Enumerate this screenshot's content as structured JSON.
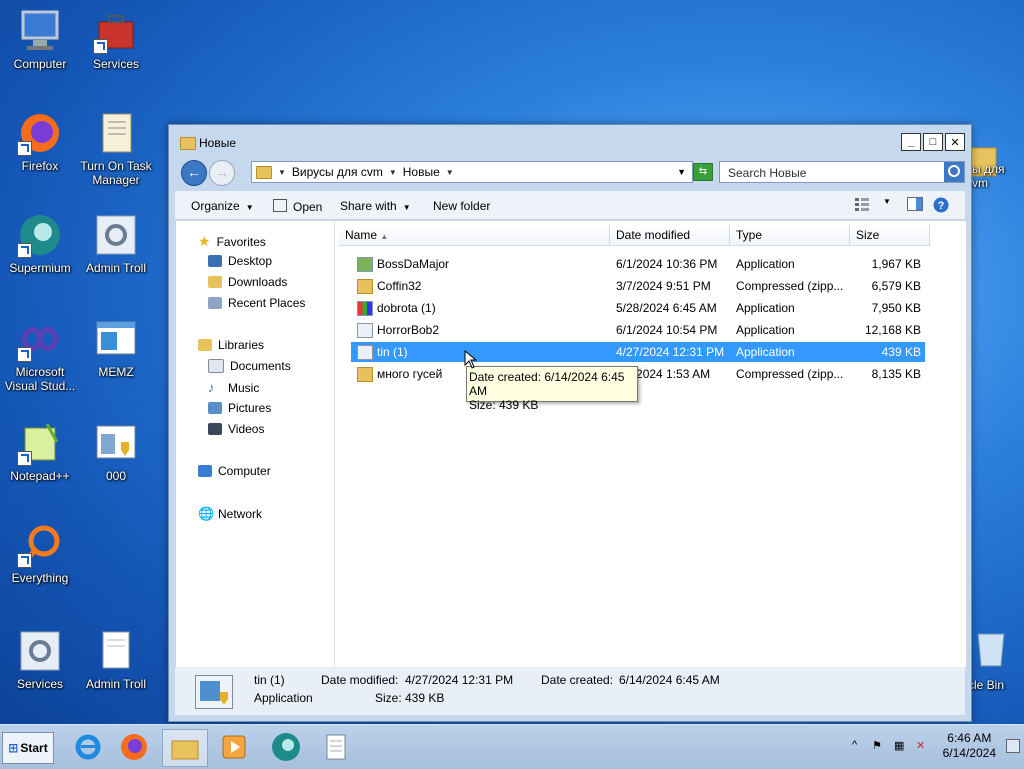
{
  "desktop": {
    "icons": [
      {
        "label": "Computer"
      },
      {
        "label": "Services"
      },
      {
        "label": "Firefox"
      },
      {
        "label": "Turn On Task Manager"
      },
      {
        "label": "Supermium"
      },
      {
        "label": "Admin Troll"
      },
      {
        "label": "Microsoft Visual Stud..."
      },
      {
        "label": "MEMZ"
      },
      {
        "label": "Notepad++"
      },
      {
        "label": "000"
      },
      {
        "label": "Everything"
      },
      {
        "label": "Services"
      },
      {
        "label": "Admin Troll"
      },
      {
        "label": "сы для\ncvm"
      },
      {
        "label": "cle Bin"
      }
    ]
  },
  "window": {
    "title": "Новые",
    "address": {
      "crumb1": "Вирусы для cvm",
      "crumb2": "Новые"
    },
    "search": {
      "placeholder": "Search Новые"
    },
    "commands": {
      "organize": "Organize",
      "open": "Open",
      "share": "Share with",
      "new_folder": "New folder"
    },
    "nav": {
      "favorites": "Favorites",
      "fav_items": [
        "Desktop",
        "Downloads",
        "Recent Places"
      ],
      "libraries": "Libraries",
      "lib_items": [
        "Documents",
        "Music",
        "Pictures",
        "Videos"
      ],
      "computer": "Computer",
      "network": "Network"
    },
    "columns": {
      "name": "Name",
      "date": "Date modified",
      "type": "Type",
      "size": "Size"
    },
    "files": [
      {
        "name": "BossDaMajor",
        "date": "6/1/2024 10:36 PM",
        "type": "Application",
        "size": "1,967 KB"
      },
      {
        "name": "Coffin32",
        "date": "3/7/2024 9:51 PM",
        "type": "Compressed (zipp...",
        "size": "6,579 KB"
      },
      {
        "name": "dobrota (1)",
        "date": "5/28/2024 6:45 AM",
        "type": "Application",
        "size": "7,950 KB"
      },
      {
        "name": "HorrorBob2",
        "date": "6/1/2024 10:54 PM",
        "type": "Application",
        "size": "12,168 KB"
      },
      {
        "name": "tin (1)",
        "date": "4/27/2024 12:31 PM",
        "type": "Application",
        "size": "439 KB"
      },
      {
        "name": "много гусей",
        "date": "5/?/2024 1:53 AM",
        "type": "Compressed (zipp...",
        "size": "8,135 KB"
      }
    ],
    "tooltip": {
      "line1": "Date created: 6/14/2024 6:45 AM",
      "line2": "Size: 439 KB"
    },
    "details": {
      "name": "tin (1)",
      "type": "Application",
      "modified_label": "Date modified:",
      "modified": "4/27/2024 12:31 PM",
      "created_label": "Date created:",
      "created": "6/14/2024 6:45 AM",
      "size_label": "Size:",
      "size": "439 KB"
    }
  },
  "taskbar": {
    "start": "Start",
    "time": "6:46 AM",
    "date": "6/14/2024"
  }
}
